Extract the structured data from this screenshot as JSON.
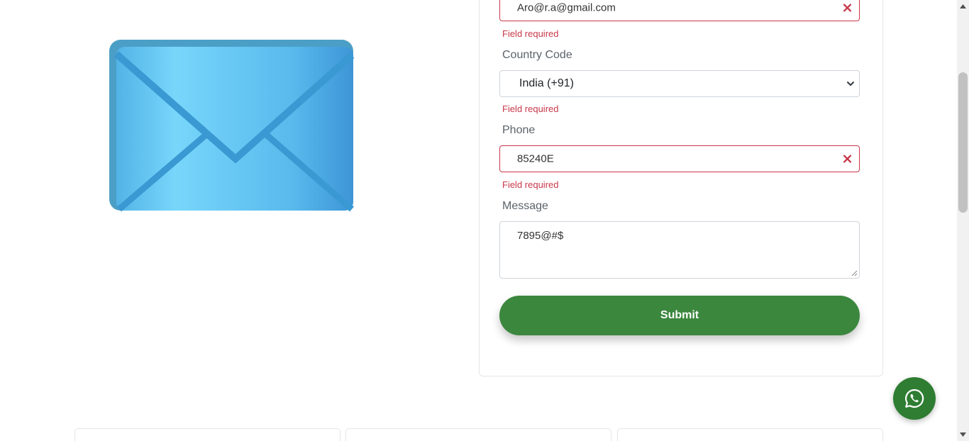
{
  "illustration": {
    "icon": "envelope-icon",
    "colors": {
      "body": "#55b8ec",
      "frame": "#4fa3c8",
      "light": "#7fd8ff",
      "fold": "#3a9ad4"
    }
  },
  "form": {
    "email": {
      "value": "Aro@r.a@gmail.com",
      "error": "Field required"
    },
    "country_code": {
      "label": "Country Code",
      "selected": "India (+91)",
      "error": "Field required"
    },
    "phone": {
      "label": "Phone",
      "value": "85240E",
      "error": "Field required"
    },
    "message": {
      "label": "Message",
      "value": "7895@#$"
    },
    "submit_label": "Submit"
  },
  "colors": {
    "error": "#c8384a",
    "submit": "#3b873e",
    "whatsapp": "#2e7d32"
  },
  "whatsapp": {
    "icon": "whatsapp-icon"
  }
}
